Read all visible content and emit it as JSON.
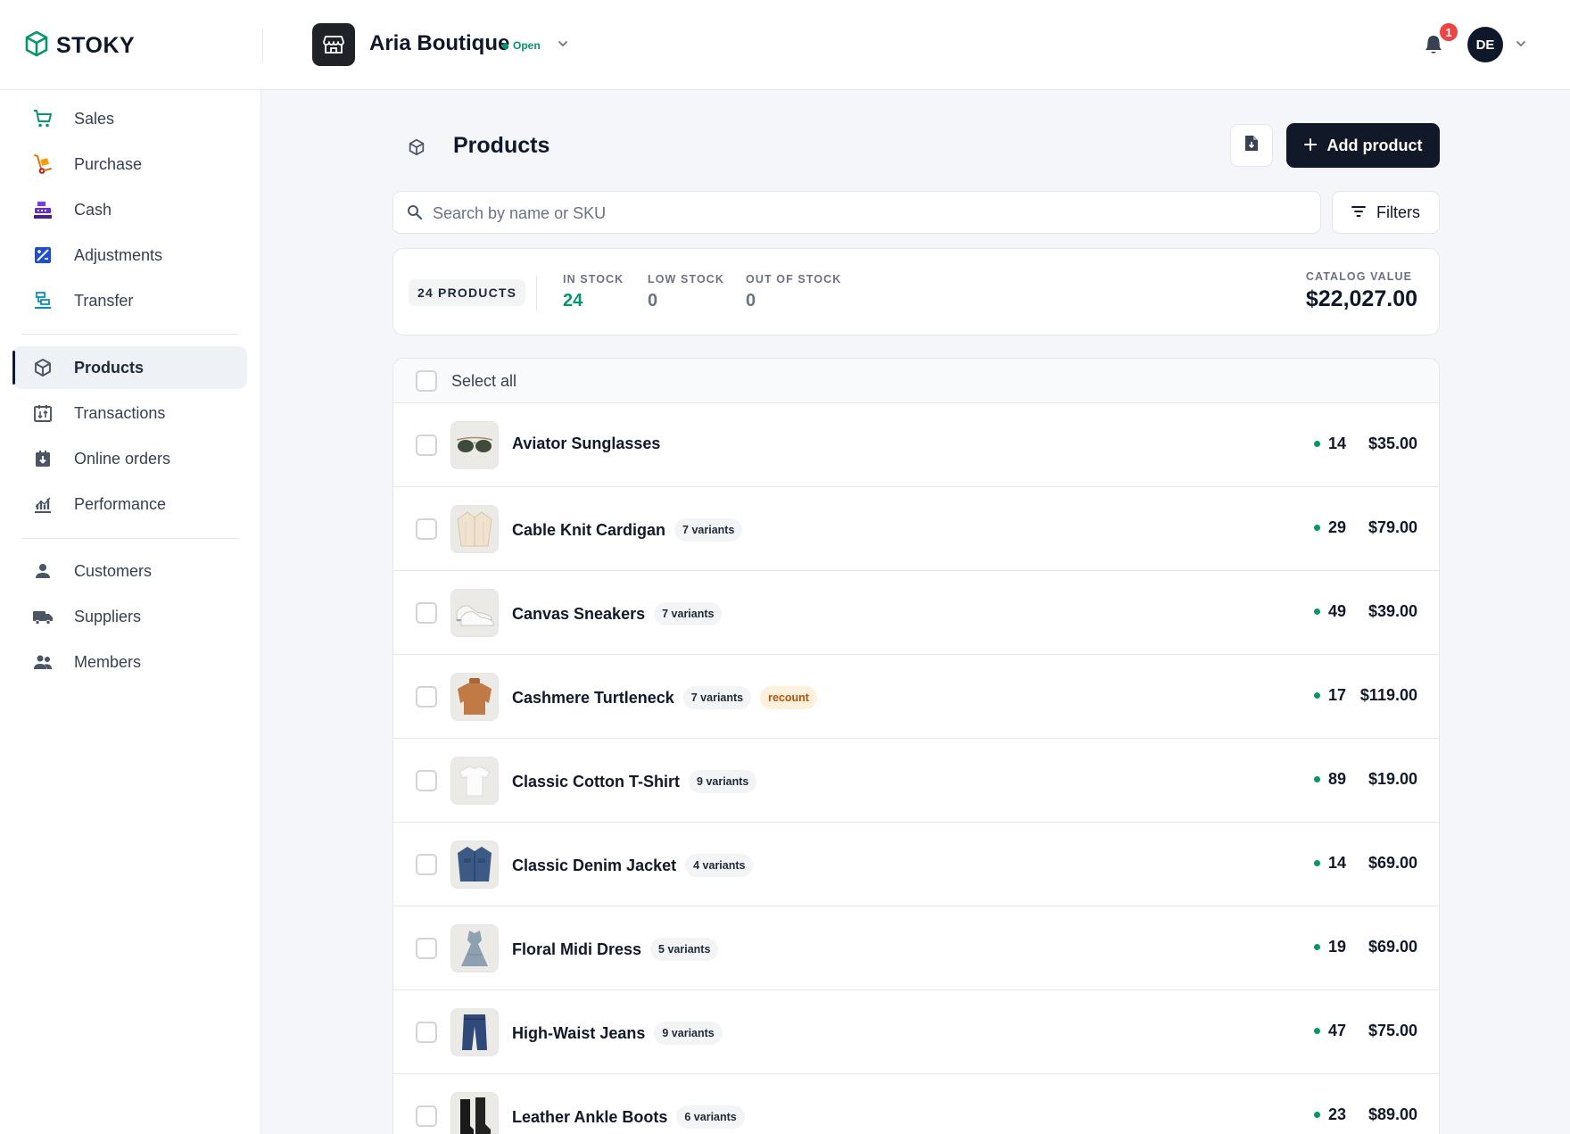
{
  "app": {
    "name": "STOKY"
  },
  "store": {
    "name": "Aria Boutique",
    "status": "Open"
  },
  "notifications": {
    "count": "1"
  },
  "user": {
    "initials": "DE"
  },
  "sidebar": {
    "groups": [
      [
        {
          "label": "Sales",
          "icon": "cart-icon",
          "color": "#059669"
        },
        {
          "label": "Purchase",
          "icon": "hand-truck-icon",
          "color": "#d97706"
        },
        {
          "label": "Cash",
          "icon": "cash-register-icon",
          "color": "#7c3aed"
        },
        {
          "label": "Adjustments",
          "icon": "adjust-icon",
          "color": "#1d4ed8"
        },
        {
          "label": "Transfer",
          "icon": "transfer-icon",
          "color": "#0891b2"
        }
      ],
      [
        {
          "label": "Products",
          "icon": "box-icon",
          "active": true
        },
        {
          "label": "Transactions",
          "icon": "calendar-icon"
        },
        {
          "label": "Online orders",
          "icon": "download-icon"
        },
        {
          "label": "Performance",
          "icon": "chart-icon"
        }
      ],
      [
        {
          "label": "Customers",
          "icon": "user-icon"
        },
        {
          "label": "Suppliers",
          "icon": "truck-icon"
        },
        {
          "label": "Members",
          "icon": "users-icon"
        }
      ]
    ]
  },
  "page": {
    "title": "Products",
    "add_label": "Add product",
    "search_placeholder": "Search by name or SKU",
    "filters_label": "Filters"
  },
  "stats": {
    "count_label": "24 PRODUCTS",
    "in_stock_label": "IN STOCK",
    "in_stock": "24",
    "low_stock_label": "LOW STOCK",
    "low_stock": "0",
    "out_of_stock_label": "OUT OF STOCK",
    "out_of_stock": "0",
    "catalog_label": "CATALOG VALUE",
    "catalog_value": "$22,027.00"
  },
  "list": {
    "select_all": "Select all",
    "products": [
      {
        "name": "Aviator Sunglasses",
        "variants": "",
        "flag": "",
        "stock": "14",
        "price": "$35.00",
        "thumb": "sunglasses"
      },
      {
        "name": "Cable Knit Cardigan",
        "variants": "7 variants",
        "flag": "",
        "stock": "29",
        "price": "$79.00",
        "thumb": "cardigan"
      },
      {
        "name": "Canvas Sneakers",
        "variants": "7 variants",
        "flag": "",
        "stock": "49",
        "price": "$39.00",
        "thumb": "sneakers"
      },
      {
        "name": "Cashmere Turtleneck",
        "variants": "7 variants",
        "flag": "recount",
        "stock": "17",
        "price": "$119.00",
        "thumb": "turtleneck"
      },
      {
        "name": "Classic Cotton T-Shirt",
        "variants": "9 variants",
        "flag": "",
        "stock": "89",
        "price": "$19.00",
        "thumb": "tshirt"
      },
      {
        "name": "Classic Denim Jacket",
        "variants": "4 variants",
        "flag": "",
        "stock": "14",
        "price": "$69.00",
        "thumb": "jacket"
      },
      {
        "name": "Floral Midi Dress",
        "variants": "5 variants",
        "flag": "",
        "stock": "19",
        "price": "$69.00",
        "thumb": "dress"
      },
      {
        "name": "High-Waist Jeans",
        "variants": "9 variants",
        "flag": "",
        "stock": "47",
        "price": "$75.00",
        "thumb": "jeans"
      },
      {
        "name": "Leather Ankle Boots",
        "variants": "6 variants",
        "flag": "",
        "stock": "23",
        "price": "$89.00",
        "thumb": "boots"
      }
    ]
  }
}
